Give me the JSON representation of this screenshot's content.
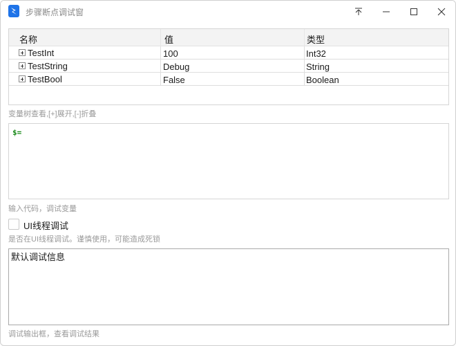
{
  "window": {
    "title": "步骤断点调试窗",
    "buttons": {
      "pin": "pin-icon",
      "minimize": "minimize-icon",
      "maximize": "maximize-icon",
      "close": "close-icon"
    },
    "accent": "#1e73e8"
  },
  "variable_grid": {
    "columns": [
      "名称",
      "值",
      "类型"
    ],
    "rows": [
      {
        "name": "TestInt",
        "value": "100",
        "type": "Int32",
        "expander": "+"
      },
      {
        "name": "TestString",
        "value": "Debug",
        "type": "String",
        "expander": "+"
      },
      {
        "name": "TestBool",
        "value": "False",
        "type": "Boolean",
        "expander": "+"
      }
    ],
    "hint": "变量树查看,[+]展开,[-]折叠"
  },
  "code_input": {
    "value": "$=",
    "value_color": "#1a8a1a",
    "hint": "输入代码，调试变量"
  },
  "ui_thread": {
    "checkbox_label": "UI线程调试",
    "checked": false,
    "hint": "是否在UI线程调试。谨慎使用，可能造成死锁"
  },
  "output": {
    "value": "默认调试信息",
    "hint": "调试输出框，查看调试结果"
  }
}
